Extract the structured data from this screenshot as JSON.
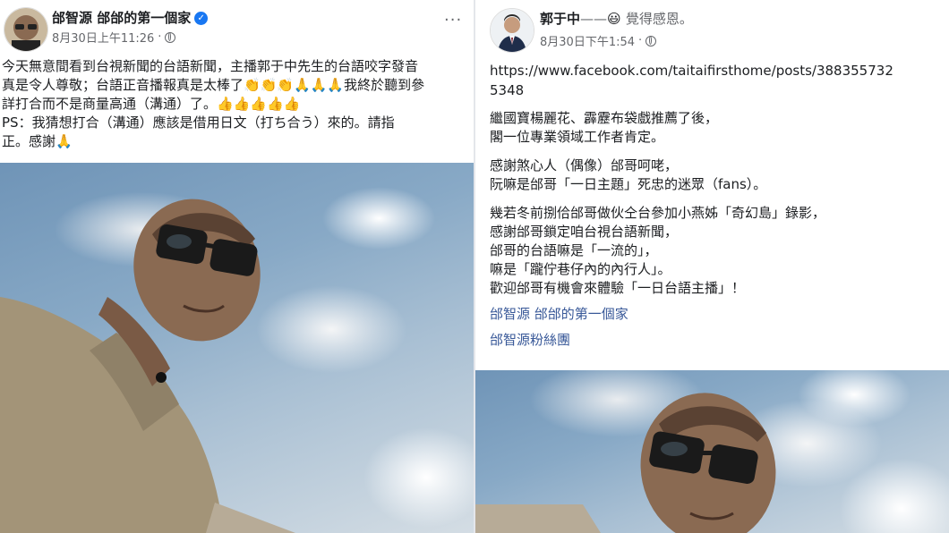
{
  "left_post": {
    "author": "邰智源 邰邰的第一個家",
    "timestamp": "8月30日上午11:26",
    "privacy_separator": "·",
    "more_label": "···",
    "text_lines": [
      "今天無意間看到台視新聞的台語新聞，主播郭于中先生的台語咬字發音",
      "真是令人尊敬；台語正音播報真是太棒了👏👏👏🙏🙏🙏我終於聽到參",
      "詳打合而不是商量高通（溝通）了。👍👍👍👍👍",
      "PS：我猜想打合（溝通）應該是借用日文（打ち合う）來的。請指",
      "正。感謝🙏"
    ]
  },
  "right_post": {
    "author": "郭于中",
    "feeling_dash": "——",
    "feeling_emoji": "😃",
    "feeling_text": "覺得感恩。",
    "timestamp": "8月30日下午1:54",
    "privacy_separator": "·",
    "url_lines": [
      "https://www.facebook.com/taitaifirsthome/posts/388355732",
      "5348"
    ],
    "paragraphs": [
      [
        "繼國寶楊麗花、霹靂布袋戲推薦了後，",
        "閣一位專業領域工作者肯定。"
      ],
      [
        "感謝煞心人（偶像）邰哥呵咾，",
        "阮嘛是邰哥「一日主題」死忠的迷眾（fans）。"
      ],
      [
        "幾若冬前捌佮邰哥做伙仝台參加小燕姊「奇幻島」錄影，",
        "感謝邰哥鎖定咱台視台語新聞，",
        "邰哥的台語嘛是「一流的」，",
        "嘛是「躘佇巷仔內的內行人」。",
        "歡迎邰哥有機會來體驗「一日台語主播」！"
      ]
    ],
    "tag_links": [
      "邰智源 邰邰的第一個家",
      "邰智源粉絲團"
    ]
  },
  "colors": {
    "link": "#385898",
    "meta": "#65676b",
    "verified": "#1877f2"
  },
  "icons": [
    "verified-badge-icon",
    "globe-icon",
    "more-options-icon"
  ]
}
